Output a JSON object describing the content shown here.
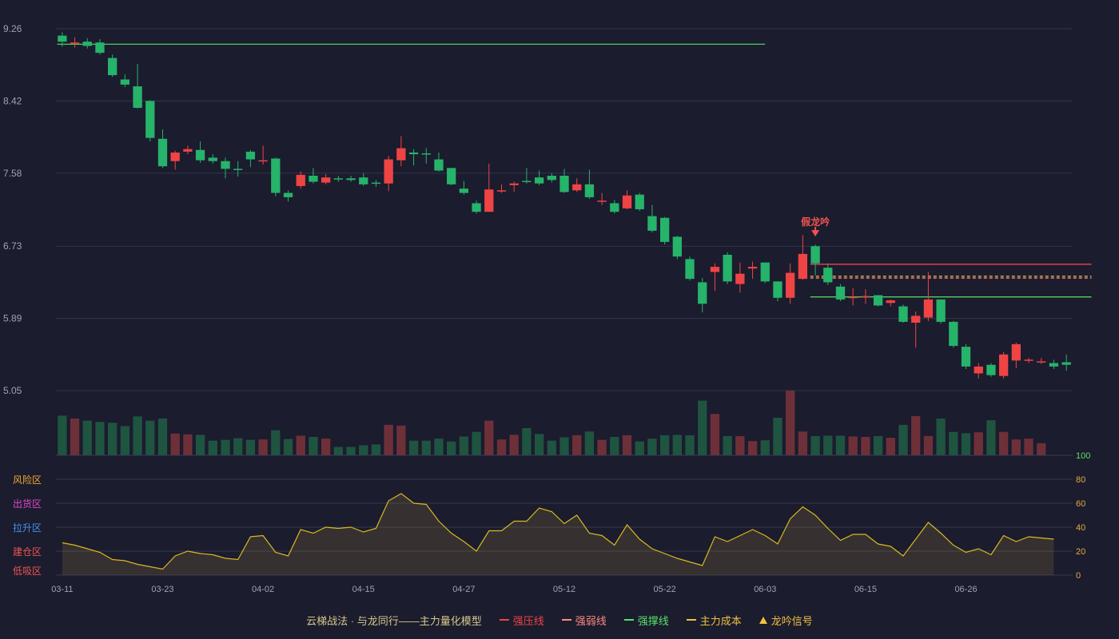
{
  "chart_data": {
    "type": "candlestick",
    "price_axis": {
      "ticks": [
        9.26,
        8.42,
        7.58,
        6.73,
        5.89,
        5.05
      ],
      "min": 5.05,
      "max": 9.26
    },
    "dates": [
      "03-11",
      "03-12",
      "03-13",
      "03-14",
      "03-17",
      "03-18",
      "03-19",
      "03-20",
      "03-21",
      "03-23",
      "03-24",
      "03-25",
      "03-26",
      "03-27",
      "03-28",
      "03-31",
      "04-01",
      "04-02",
      "04-03",
      "04-07",
      "04-08",
      "04-09",
      "04-10",
      "04-11",
      "04-14",
      "04-15",
      "04-16",
      "04-17",
      "04-18",
      "04-21",
      "04-22",
      "04-23",
      "04-24",
      "04-25",
      "04-27",
      "04-28",
      "04-29",
      "04-30",
      "05-06",
      "05-07",
      "05-08",
      "05-09",
      "05-12",
      "05-13",
      "05-14",
      "05-15",
      "05-16",
      "05-19",
      "05-20",
      "05-21",
      "05-22",
      "05-23",
      "05-26",
      "05-27",
      "05-28",
      "05-29",
      "05-30",
      "06-02",
      "06-03",
      "06-04",
      "06-05",
      "06-06",
      "06-09",
      "06-10",
      "06-11",
      "06-12",
      "06-13",
      "06-15",
      "06-16",
      "06-17",
      "06-18",
      "06-19",
      "06-20",
      "06-23",
      "06-24",
      "06-25",
      "06-26",
      "06-27",
      "06-30",
      "07-01",
      "07-02",
      "07-03",
      "07-04"
    ],
    "x_tick_labels": [
      "03-11",
      "03-23",
      "04-02",
      "04-15",
      "04-27",
      "05-12",
      "05-22",
      "06-03",
      "06-15",
      "06-26"
    ],
    "x_tick_indices": [
      0,
      8,
      16,
      24,
      32,
      40,
      48,
      56,
      64,
      72
    ],
    "ohlc": [
      [
        9.18,
        9.11,
        9.22,
        9.05
      ],
      [
        9.09,
        9.1,
        9.16,
        9.04
      ],
      [
        9.11,
        9.06,
        9.15,
        9.03
      ],
      [
        9.1,
        8.98,
        9.14,
        8.96
      ],
      [
        8.92,
        8.72,
        8.96,
        8.7
      ],
      [
        8.67,
        8.61,
        8.73,
        8.58
      ],
      [
        8.59,
        8.34,
        8.85,
        8.33
      ],
      [
        8.42,
        7.99,
        8.43,
        7.95
      ],
      [
        7.98,
        7.66,
        8.09,
        7.64
      ],
      [
        7.72,
        7.82,
        7.84,
        7.62
      ],
      [
        7.83,
        7.86,
        7.9,
        7.8
      ],
      [
        7.85,
        7.73,
        7.95,
        7.7
      ],
      [
        7.76,
        7.72,
        7.8,
        7.69
      ],
      [
        7.72,
        7.63,
        7.76,
        7.52
      ],
      [
        7.63,
        7.62,
        7.72,
        7.54
      ],
      [
        7.83,
        7.74,
        7.85,
        7.65
      ],
      [
        7.72,
        7.73,
        7.9,
        7.68
      ],
      [
        7.75,
        7.35,
        7.76,
        7.31
      ],
      [
        7.35,
        7.3,
        7.38,
        7.25
      ],
      [
        7.43,
        7.56,
        7.6,
        7.4
      ],
      [
        7.55,
        7.48,
        7.64,
        7.46
      ],
      [
        7.47,
        7.53,
        7.57,
        7.45
      ],
      [
        7.52,
        7.51,
        7.55,
        7.48
      ],
      [
        7.52,
        7.5,
        7.55,
        7.48
      ],
      [
        7.53,
        7.45,
        7.58,
        7.43
      ],
      [
        7.47,
        7.46,
        7.5,
        7.42
      ],
      [
        7.46,
        7.74,
        7.78,
        7.37
      ],
      [
        7.73,
        7.87,
        8.01,
        7.66
      ],
      [
        7.82,
        7.8,
        7.86,
        7.67
      ],
      [
        7.81,
        7.8,
        7.87,
        7.69
      ],
      [
        7.74,
        7.61,
        7.82,
        7.6
      ],
      [
        7.64,
        7.45,
        7.64,
        7.44
      ],
      [
        7.4,
        7.35,
        7.49,
        7.33
      ],
      [
        7.23,
        7.13,
        7.26,
        7.11
      ],
      [
        7.13,
        7.39,
        7.69,
        7.13
      ],
      [
        7.37,
        7.38,
        7.45,
        7.35
      ],
      [
        7.44,
        7.46,
        7.48,
        7.36
      ],
      [
        7.49,
        7.48,
        7.64,
        7.46
      ],
      [
        7.53,
        7.46,
        7.61,
        7.44
      ],
      [
        7.55,
        7.5,
        7.58,
        7.47
      ],
      [
        7.55,
        7.36,
        7.63,
        7.35
      ],
      [
        7.38,
        7.45,
        7.52,
        7.36
      ],
      [
        7.45,
        7.3,
        7.62,
        7.28
      ],
      [
        7.25,
        7.26,
        7.35,
        7.21
      ],
      [
        7.23,
        7.13,
        7.27,
        7.11
      ],
      [
        7.17,
        7.32,
        7.38,
        7.16
      ],
      [
        7.33,
        7.16,
        7.35,
        7.14
      ],
      [
        7.08,
        6.91,
        7.21,
        6.89
      ],
      [
        7.06,
        6.78,
        7.07,
        6.75
      ],
      [
        6.84,
        6.61,
        6.85,
        6.58
      ],
      [
        6.58,
        6.35,
        6.61,
        6.33
      ],
      [
        6.31,
        6.06,
        6.36,
        5.96
      ],
      [
        6.43,
        6.49,
        6.53,
        6.21
      ],
      [
        6.63,
        6.32,
        6.66,
        6.29
      ],
      [
        6.29,
        6.41,
        6.54,
        6.19
      ],
      [
        6.47,
        6.49,
        6.55,
        6.35
      ],
      [
        6.54,
        6.32,
        6.54,
        6.3
      ],
      [
        6.32,
        6.13,
        6.32,
        6.09
      ],
      [
        6.13,
        6.42,
        6.53,
        6.06
      ],
      [
        6.35,
        6.64,
        6.86,
        6.34
      ],
      [
        6.73,
        6.53,
        6.75,
        6.39
      ],
      [
        6.48,
        6.31,
        6.53,
        6.28
      ],
      [
        6.26,
        6.11,
        6.29,
        6.09
      ],
      [
        6.13,
        6.14,
        6.24,
        6.04
      ],
      [
        6.15,
        6.15,
        6.23,
        6.06
      ],
      [
        6.16,
        6.04,
        6.16,
        6.03
      ],
      [
        6.07,
        6.1,
        6.11,
        6.03
      ],
      [
        6.03,
        5.85,
        6.05,
        5.84
      ],
      [
        5.84,
        5.92,
        5.97,
        5.55
      ],
      [
        5.9,
        6.11,
        6.43,
        5.86
      ],
      [
        6.11,
        5.85,
        6.11,
        5.83
      ],
      [
        5.85,
        5.57,
        5.86,
        5.55
      ],
      [
        5.56,
        5.33,
        5.59,
        5.3
      ],
      [
        5.25,
        5.33,
        5.37,
        5.19
      ],
      [
        5.35,
        5.23,
        5.37,
        5.21
      ],
      [
        5.22,
        5.47,
        5.5,
        5.19
      ],
      [
        5.4,
        5.59,
        5.61,
        5.31
      ],
      [
        5.41,
        5.41,
        5.43,
        5.37
      ],
      [
        5.39,
        5.39,
        5.43,
        5.36
      ],
      [
        5.37,
        5.33,
        5.41,
        5.3
      ],
      [
        5.38,
        5.35,
        5.47,
        5.28
      ]
    ],
    "volume": [
      95,
      88,
      83,
      80,
      78,
      70,
      93,
      83,
      88,
      52,
      50,
      49,
      35,
      37,
      41,
      37,
      38,
      60,
      39,
      47,
      44,
      40,
      20,
      20,
      24,
      26,
      73,
      71,
      35,
      35,
      40,
      33,
      45,
      56,
      83,
      38,
      49,
      65,
      51,
      35,
      43,
      48,
      57,
      37,
      44,
      48,
      33,
      40,
      48,
      49,
      48,
      131,
      99,
      46,
      46,
      34,
      36,
      90,
      155,
      57,
      46,
      47,
      47,
      45,
      44,
      46,
      42,
      73,
      94,
      46,
      88,
      56,
      53,
      55,
      84,
      56,
      38,
      40,
      29
    ],
    "lines": [
      {
        "name": "强压线",
        "color": "#ef4444",
        "y": 6.52,
        "from": "06-05",
        "to": "07-04",
        "style": "solid"
      },
      {
        "name": "强弱线",
        "color": "#ff8a80",
        "y": 6.36,
        "from": "06-05",
        "to": "07-04",
        "style": "dashed"
      },
      {
        "name": "强撑线",
        "color": "#58e06a",
        "y": 6.14,
        "from": "06-05",
        "to": "07-04",
        "style": "solid"
      },
      {
        "name": "主力成本",
        "color": "#f0c040",
        "y": 6.38,
        "from": "06-05",
        "to": "07-04",
        "style": "dashed"
      },
      {
        "name": "",
        "color": "#4ccf5d",
        "y": 9.08,
        "from": "03-11",
        "to": "05-30",
        "style": "solid"
      }
    ],
    "signal": {
      "label": "假龙吟",
      "date": "06-05",
      "color": "#ef5350"
    },
    "indicator": {
      "axis_ticks": [
        100,
        80,
        60,
        40,
        20,
        0
      ],
      "zones": [
        {
          "label": "风险区",
          "value": 80,
          "color": "#f0a830"
        },
        {
          "label": "出货区",
          "value": 60,
          "color": "#e048c8"
        },
        {
          "label": "拉升区",
          "value": 40,
          "color": "#4a90e8"
        },
        {
          "label": "建仓区",
          "value": 20,
          "color": "#ef5350"
        },
        {
          "label": "低吸区",
          "value": 0,
          "color": "#ef5350"
        }
      ],
      "values": [
        27,
        25,
        22,
        19,
        13,
        12,
        9,
        7,
        5,
        16,
        20,
        18,
        17,
        14,
        13,
        32,
        33,
        19,
        16,
        38,
        35,
        40,
        39,
        40,
        36,
        39,
        62,
        68,
        60,
        59,
        45,
        35,
        28,
        20,
        37,
        37,
        45,
        45,
        56,
        53,
        43,
        50,
        35,
        33,
        25,
        42,
        30,
        22,
        18,
        14,
        11,
        8,
        32,
        28,
        33,
        38,
        33,
        26,
        47,
        57,
        50,
        39,
        29,
        34,
        34,
        26,
        24,
        16,
        30,
        44,
        35,
        25,
        19,
        22,
        17,
        33,
        28,
        32,
        31,
        30
      ]
    },
    "colors": {
      "up": "#ef4444",
      "down": "#26b36a",
      "up_vol": "#6e3038",
      "down_vol": "#1f5440",
      "indicator_line": "#d8b820"
    }
  },
  "legend": {
    "model": "云梯战法 · 与龙同行——主力量化模型",
    "items": [
      {
        "label": "强压线",
        "color": "#ef4444"
      },
      {
        "label": "强弱线",
        "color": "#ff8a80"
      },
      {
        "label": "强撑线",
        "color": "#58e06a"
      },
      {
        "label": "主力成本",
        "color": "#f0c040"
      },
      {
        "label": "龙吟信号",
        "color": "#f0c040"
      }
    ]
  }
}
